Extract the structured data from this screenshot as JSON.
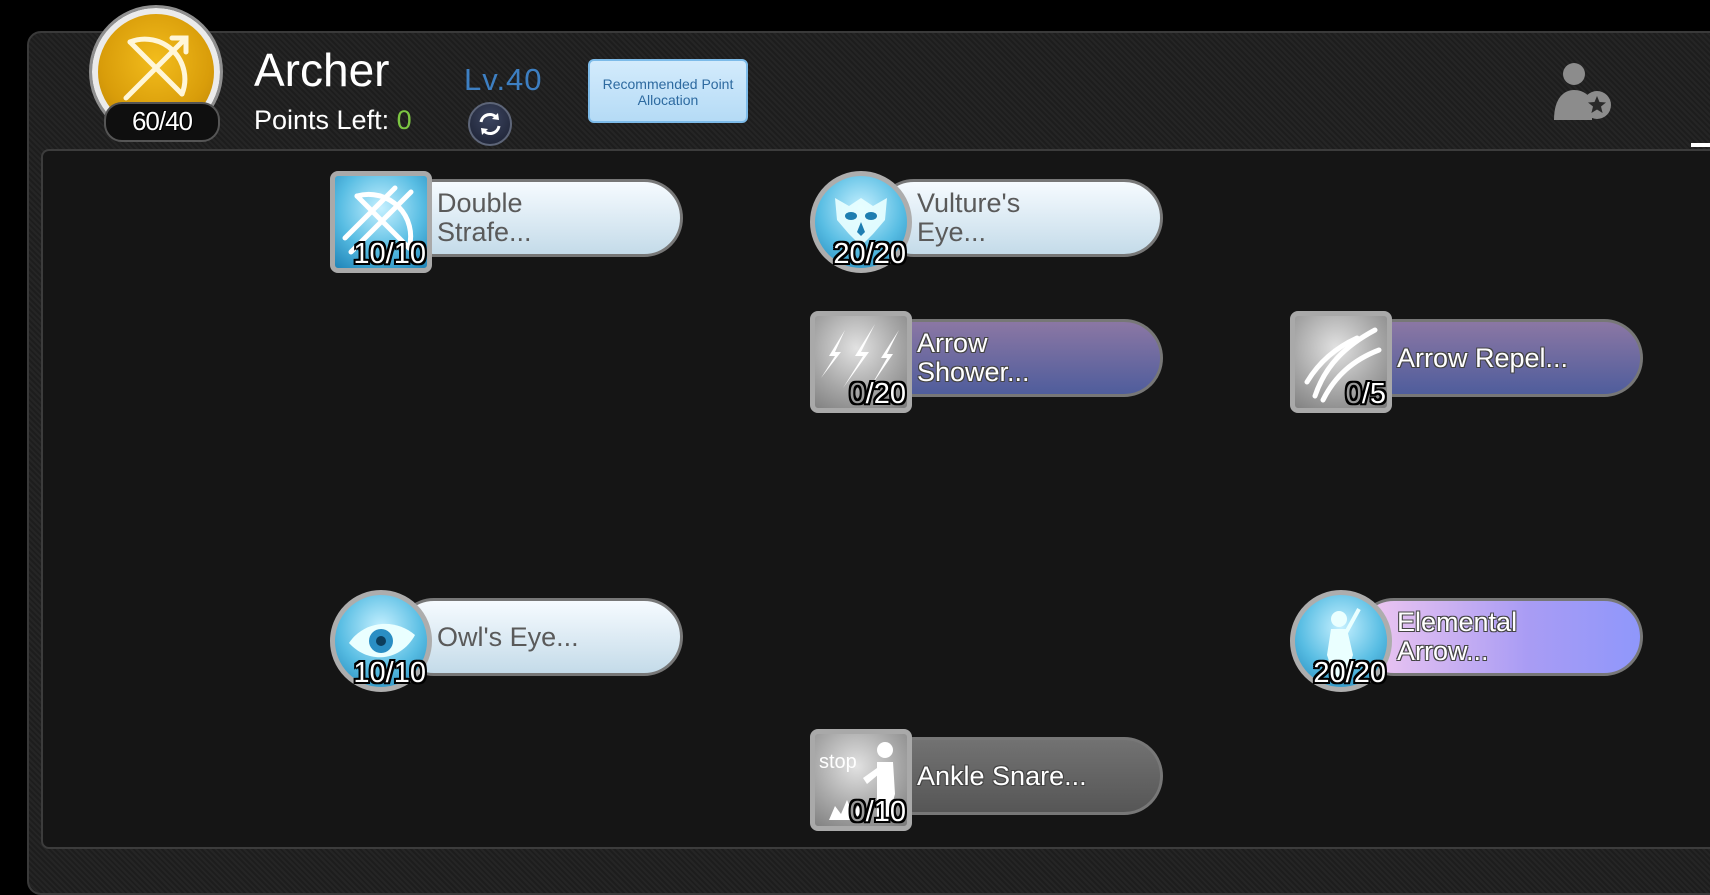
{
  "header": {
    "class_name": "Archer",
    "emblem_count": "60/40",
    "points_left_label": "Points Left:",
    "points_left_value": "0",
    "level": "Lv.40",
    "recommended_line1": "Recommended Point",
    "recommended_line2": "Allocation"
  },
  "skills": [
    {
      "name_1": "Double",
      "name_2": "Strafe...",
      "current": "10",
      "max": "/10",
      "icon": "bow-arrows-icon",
      "style": "light",
      "level": 1.0
    },
    {
      "name_1": "Vulture's",
      "name_2": "Eye...",
      "current": "20",
      "max": "/20",
      "icon": "vulture-icon",
      "style": "light",
      "level": 1.0
    },
    {
      "name_1": "Arrow",
      "name_2": "Shower...",
      "current": "0",
      "max": "/20",
      "icon": "arrow-shower-icon",
      "style": "purple",
      "level": 0.0
    },
    {
      "name_1": "Arrow Repel...",
      "current": "0",
      "max": "/5",
      "icon": "arrow-repel-icon",
      "style": "purple",
      "level": 0.0
    },
    {
      "name_1": "Owl's Eye...",
      "current": "10",
      "max": "/10",
      "icon": "owl-eye-icon",
      "style": "light",
      "level": 1.0
    },
    {
      "name_1": "Elemental",
      "name_2": "Arrow...",
      "current": "20",
      "max": "/20",
      "icon": "elemental-archer-icon",
      "style": "lilac",
      "level": 1.0
    },
    {
      "name_1": "Ankle Snare...",
      "current": "0",
      "max": "/10",
      "icon": "ankle-snare-icon",
      "style": "gray",
      "level": 0.0
    }
  ],
  "icons": {
    "class": "bow-icon",
    "reset": "refresh-icon",
    "profile": "user-star-icon"
  },
  "colors": {
    "accent_gold": "#e0a40c",
    "points_green": "#7cc642",
    "level_blue": "#3d7fc2"
  }
}
